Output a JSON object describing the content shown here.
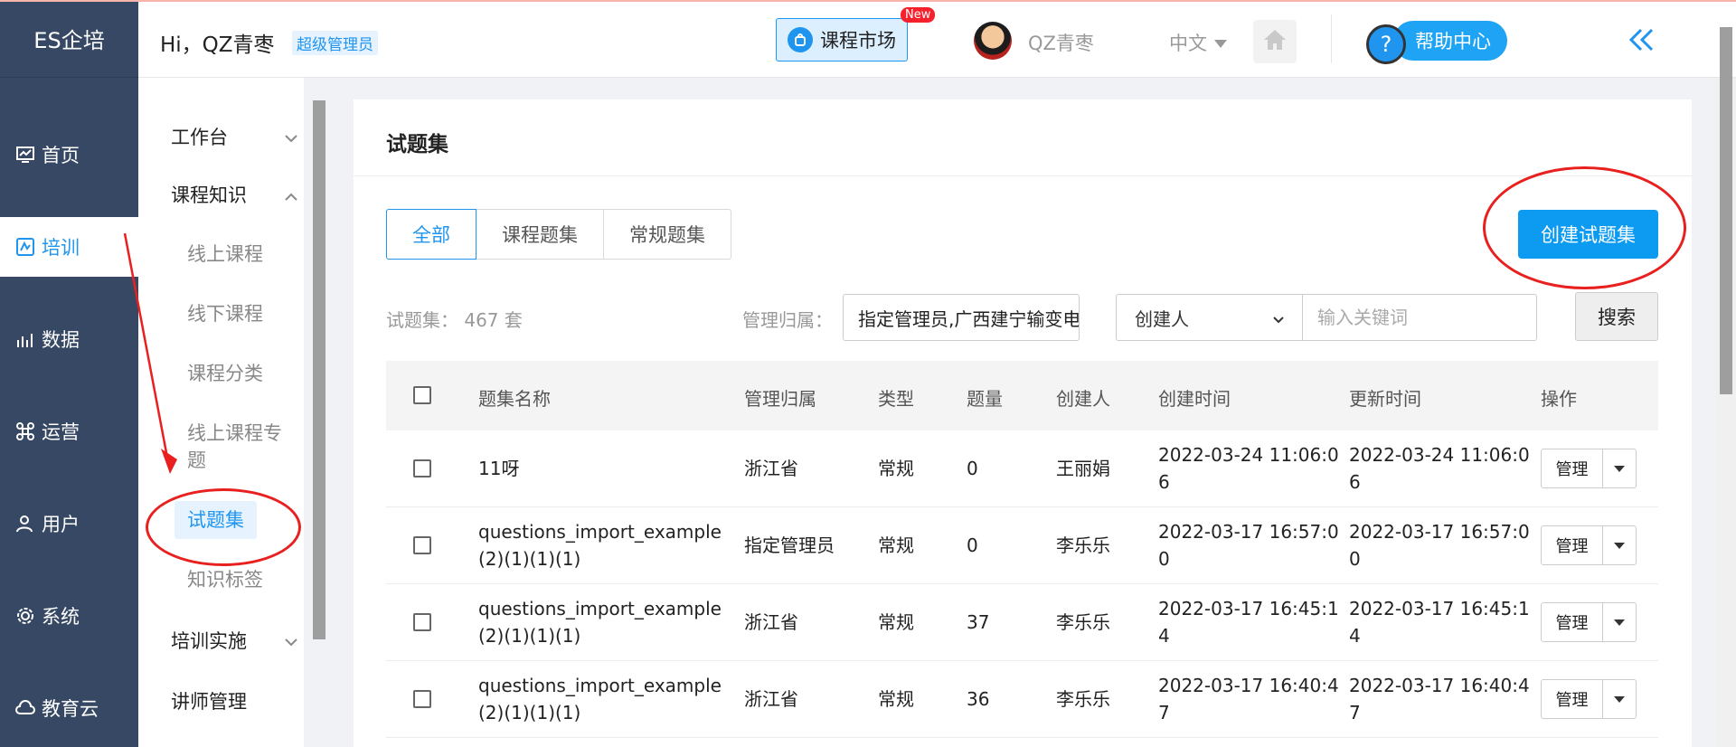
{
  "app": {
    "logo": "ES企培"
  },
  "side_nav": [
    {
      "label": "首页",
      "icon": "dashboard-icon",
      "active": false
    },
    {
      "label": "培训",
      "icon": "training-icon",
      "active": true
    },
    {
      "label": "数据",
      "icon": "chart-icon",
      "active": false
    },
    {
      "label": "运营",
      "icon": "command-icon",
      "active": false
    },
    {
      "label": "用户",
      "icon": "user-icon",
      "active": false
    },
    {
      "label": "系统",
      "icon": "gear-icon",
      "active": false
    },
    {
      "label": "教育云",
      "icon": "cloud-icon",
      "active": false
    }
  ],
  "header": {
    "greeting": "Hi，QZ青枣",
    "role": "超级管理员",
    "market": "课程市场",
    "new_tag": "New",
    "username": "QZ青枣",
    "language": "中文",
    "help": "帮助中心",
    "help_q": "?"
  },
  "submenu": {
    "groups": [
      {
        "label": "工作台",
        "expanded": false
      },
      {
        "label": "课程知识",
        "expanded": true
      },
      {
        "label": "培训实施",
        "expanded": false
      },
      {
        "label": "讲师管理"
      }
    ],
    "items": [
      {
        "label": "线上课程"
      },
      {
        "label": "线下课程"
      },
      {
        "label": "课程分类"
      },
      {
        "label": "线上课程专题"
      },
      {
        "label": "试题集",
        "active": true
      },
      {
        "label": "知识标签"
      }
    ]
  },
  "page": {
    "title": "试题集",
    "tabs": [
      "全部",
      "课程题集",
      "常规题集"
    ],
    "active_tab": 0,
    "create_button": "创建试题集",
    "count_label": "试题集：",
    "count_value": "467 套",
    "manager_label": "管理归属：",
    "manager_value": "指定管理员,广西建宁输变电",
    "creator_select": "创建人",
    "keyword_placeholder": "输入关键词",
    "search_button": "搜索"
  },
  "table": {
    "columns": [
      "题集名称",
      "管理归属",
      "类型",
      "题量",
      "创建人",
      "创建时间",
      "更新时间",
      "操作"
    ],
    "rows": [
      {
        "name1": "11呀",
        "name2": "",
        "owner": "浙江省",
        "type": "常规",
        "qty": "0",
        "creator": "王丽娟",
        "created1": "2022-03-24 11:06:0",
        "created2": "6",
        "updated1": "2022-03-24 11:06:0",
        "updated2": "6",
        "action": "管理"
      },
      {
        "name1": "questions_import_example",
        "name2": "(2)(1)(1)(1)",
        "owner": "指定管理员",
        "type": "常规",
        "qty": "0",
        "creator": "李乐乐",
        "created1": "2022-03-17 16:57:0",
        "created2": "0",
        "updated1": "2022-03-17 16:57:0",
        "updated2": "0",
        "action": "管理"
      },
      {
        "name1": "questions_import_example",
        "name2": "(2)(1)(1)(1)",
        "owner": "浙江省",
        "type": "常规",
        "qty": "37",
        "creator": "李乐乐",
        "created1": "2022-03-17 16:45:1",
        "created2": "4",
        "updated1": "2022-03-17 16:45:1",
        "updated2": "4",
        "action": "管理"
      },
      {
        "name1": "questions_import_example",
        "name2": "(2)(1)(1)(1)",
        "owner": "浙江省",
        "type": "常规",
        "qty": "36",
        "creator": "李乐乐",
        "created1": "2022-03-17 16:40:4",
        "created2": "7",
        "updated1": "2022-03-17 16:40:4",
        "updated2": "7",
        "action": "管理"
      }
    ]
  },
  "colors": {
    "accent": "#1f95ef",
    "sidebar": "#364863",
    "annotation": "#e8201f"
  }
}
